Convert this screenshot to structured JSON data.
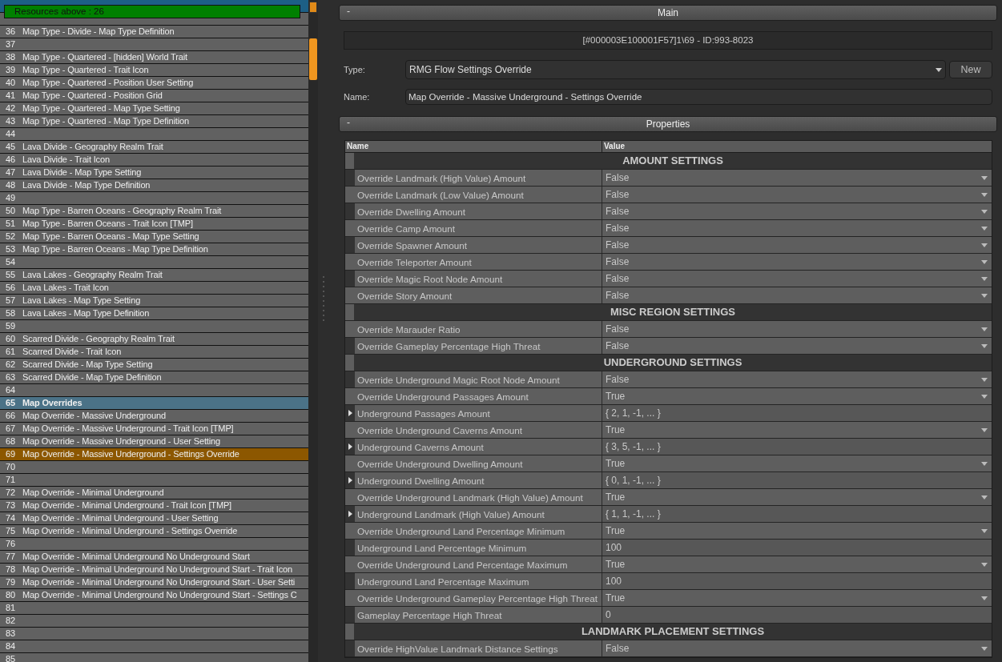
{
  "resource_list": {
    "banner": "Resources above : 26",
    "rows": [
      {
        "number": "36",
        "label": "Map Type - Divide - Map Type Definition",
        "kind": "item",
        "selected": false
      },
      {
        "number": "37",
        "kind": "item",
        "selected": false
      },
      {
        "number": "38",
        "label": "Map Type - Quartered - [hidden] World Trait",
        "kind": "item",
        "selected": false
      },
      {
        "number": "39",
        "label": "Map Type - Quartered - Trait Icon",
        "kind": "item",
        "selected": false
      },
      {
        "number": "40",
        "label": "Map Type - Quartered - Position User Setting",
        "kind": "item",
        "selected": false
      },
      {
        "number": "41",
        "label": "Map Type - Quartered - Position Grid",
        "kind": "item",
        "selected": false
      },
      {
        "number": "42",
        "label": "Map Type - Quartered - Map Type Setting",
        "kind": "item",
        "selected": false
      },
      {
        "number": "43",
        "label": "Map Type - Quartered - Map Type Definition",
        "kind": "item",
        "selected": false
      },
      {
        "number": "44",
        "kind": "item",
        "selected": false
      },
      {
        "number": "45",
        "label": "Lava Divide - Geography Realm Trait",
        "kind": "item",
        "selected": false
      },
      {
        "number": "46",
        "label": "Lava Divide - Trait Icon",
        "kind": "item",
        "selected": false
      },
      {
        "number": "47",
        "label": "Lava Divide - Map Type Setting",
        "kind": "item",
        "selected": false
      },
      {
        "number": "48",
        "label": "Lava Divide - Map Type Definition",
        "kind": "item",
        "selected": false
      },
      {
        "number": "49",
        "kind": "item",
        "selected": false
      },
      {
        "number": "50",
        "label": "Map Type - Barren Oceans - Geography Realm Trait",
        "kind": "item",
        "selected": false
      },
      {
        "number": "51",
        "label": "Map Type - Barren Oceans - Trait Icon [TMP]",
        "kind": "item",
        "selected": false
      },
      {
        "number": "52",
        "label": "Map Type - Barren Oceans - Map Type Setting",
        "kind": "item",
        "selected": false
      },
      {
        "number": "53",
        "label": "Map Type - Barren Oceans - Map Type Definition",
        "kind": "item",
        "selected": false
      },
      {
        "number": "54",
        "kind": "item",
        "selected": false
      },
      {
        "number": "55",
        "label": "Lava Lakes - Geography Realm Trait",
        "kind": "item",
        "selected": false
      },
      {
        "number": "56",
        "label": "Lava Lakes - Trait Icon",
        "kind": "item",
        "selected": false
      },
      {
        "number": "57",
        "label": "Lava Lakes - Map Type Setting",
        "kind": "item",
        "selected": false
      },
      {
        "number": "58",
        "label": "Lava Lakes - Map Type Definition",
        "kind": "item",
        "selected": false
      },
      {
        "number": "59",
        "kind": "item",
        "selected": false
      },
      {
        "number": "60",
        "label": "Scarred Divide - Geography Realm Trait",
        "kind": "item",
        "selected": false
      },
      {
        "number": "61",
        "label": "Scarred Divide - Trait Icon",
        "kind": "item",
        "selected": false
      },
      {
        "number": "62",
        "label": "Scarred Divide - Map Type Setting",
        "kind": "item",
        "selected": false
      },
      {
        "number": "63",
        "label": "Scarred Divide - Map Type Definition",
        "kind": "item",
        "selected": false
      },
      {
        "number": "64",
        "kind": "item",
        "selected": false
      },
      {
        "number": "65",
        "label": "Map Overrides",
        "kind": "header",
        "selected": false
      },
      {
        "number": "66",
        "label": "Map Override - Massive Underground",
        "kind": "item",
        "selected": false
      },
      {
        "number": "67",
        "label": "Map Override - Massive Underground - Trait Icon [TMP]",
        "kind": "item",
        "selected": false
      },
      {
        "number": "68",
        "label": "Map Override - Massive Underground - User Setting",
        "kind": "item",
        "selected": false
      },
      {
        "number": "69",
        "label": "Map Override - Massive Underground - Settings Override",
        "kind": "item",
        "selected": true
      },
      {
        "number": "70",
        "kind": "item",
        "selected": false
      },
      {
        "number": "71",
        "kind": "item",
        "selected": false
      },
      {
        "number": "72",
        "label": "Map Override - Minimal Underground",
        "kind": "item",
        "selected": false
      },
      {
        "number": "73",
        "label": "Map Override - Minimal Underground - Trait Icon [TMP]",
        "kind": "item",
        "selected": false
      },
      {
        "number": "74",
        "label": "Map Override - Minimal Underground - User Setting",
        "kind": "item",
        "selected": false
      },
      {
        "number": "75",
        "label": "Map Override - Minimal Underground - Settings Override",
        "kind": "item",
        "selected": false
      },
      {
        "number": "76",
        "kind": "item",
        "selected": false
      },
      {
        "number": "77",
        "label": "Map Override - Minimal Underground No Underground Start",
        "kind": "item",
        "selected": false
      },
      {
        "number": "78",
        "label": "Map Override - Minimal Underground No Underground Start - Trait Icon",
        "kind": "item",
        "selected": false
      },
      {
        "number": "79",
        "label": "Map Override - Minimal Underground No Underground Start - User Setti",
        "kind": "item",
        "selected": false
      },
      {
        "number": "80",
        "label": "Map Override - Minimal Underground No Underground Start - Settings C",
        "kind": "item",
        "selected": false
      },
      {
        "number": "81",
        "kind": "item",
        "selected": false
      },
      {
        "number": "82",
        "kind": "item",
        "selected": false
      },
      {
        "number": "83",
        "kind": "item",
        "selected": false
      },
      {
        "number": "84",
        "kind": "item",
        "selected": false
      },
      {
        "number": "85",
        "kind": "item",
        "selected": false
      }
    ]
  },
  "main": {
    "title": "Main",
    "collapse": "-",
    "id_text": "[#000003E100001F57]1\\69 - ID:993-8023",
    "type_label": "Type:",
    "type_value": "RMG Flow Settings Override",
    "new_button": "New",
    "name_label": "Name:",
    "name_value": "Map Override - Massive Underground - Settings Override"
  },
  "properties": {
    "title": "Properties",
    "collapse": "-",
    "columns": [
      "Name",
      "Value"
    ],
    "rows": [
      {
        "kind": "section",
        "name": "AMOUNT SETTINGS"
      },
      {
        "kind": "dropdown",
        "name": "Override Landmark (High Value) Amount",
        "value": "False"
      },
      {
        "kind": "dropdown",
        "name": "Override Landmark (Low Value) Amount",
        "value": "False"
      },
      {
        "kind": "dropdown",
        "name": "Override Dwelling  Amount",
        "value": "False"
      },
      {
        "kind": "dropdown",
        "name": "Override Camp Amount",
        "value": "False"
      },
      {
        "kind": "dropdown",
        "name": "Override Spawner Amount",
        "value": "False"
      },
      {
        "kind": "dropdown",
        "name": "Override Teleporter Amount",
        "value": "False"
      },
      {
        "kind": "dropdown",
        "name": "Override Magic Root Node Amount",
        "value": "False"
      },
      {
        "kind": "dropdown",
        "name": "Override Story Amount",
        "value": "False"
      },
      {
        "kind": "section",
        "name": "MISC REGION SETTINGS"
      },
      {
        "kind": "dropdown",
        "name": "Override Marauder Ratio",
        "value": "False"
      },
      {
        "kind": "dropdown",
        "name": "Override Gameplay Percentage High Threat",
        "value": "False"
      },
      {
        "kind": "section",
        "name": "UNDERGROUND SETTINGS"
      },
      {
        "kind": "dropdown",
        "name": "Override Underground Magic Root Node Amount",
        "value": "False"
      },
      {
        "kind": "dropdown",
        "name": "Override Underground Passages Amount",
        "value": "True"
      },
      {
        "kind": "array",
        "name": "Underground Passages Amount",
        "value": "{ 2, 1, -1, ... }",
        "expanded": false
      },
      {
        "kind": "dropdown",
        "name": "Override Underground Caverns Amount",
        "value": "True"
      },
      {
        "kind": "array",
        "name": "Underground Caverns Amount",
        "value": "{ 3, 5, -1, ... }",
        "expanded": false
      },
      {
        "kind": "dropdown",
        "name": "Override Underground Dwelling Amount",
        "value": "True"
      },
      {
        "kind": "array",
        "name": "Underground Dwelling Amount",
        "value": "{ 0, 1, -1, ... }",
        "expanded": false
      },
      {
        "kind": "dropdown",
        "name": "Override Underground Landmark (High Value) Amount",
        "value": "True"
      },
      {
        "kind": "array",
        "name": "Underground Landmark (High Value) Amount",
        "value": "{ 1, 1, -1, ... }",
        "expanded": false
      },
      {
        "kind": "dropdown",
        "name": "Override Underground Land Percentage Minimum",
        "value": "True"
      },
      {
        "kind": "number",
        "name": "Underground Land Percentage Minimum",
        "value": "100"
      },
      {
        "kind": "dropdown",
        "name": "Override Underground Land Percentage Maximum",
        "value": "True"
      },
      {
        "kind": "number",
        "name": "Underground Land Percentage Maximum",
        "value": "100"
      },
      {
        "kind": "dropdown",
        "name": "Override Underground Gameplay Percentage High Threat",
        "value": "True"
      },
      {
        "kind": "number",
        "name": "Gameplay Percentage High Threat",
        "value": "0"
      },
      {
        "kind": "section",
        "name": "LANDMARK PLACEMENT SETTINGS"
      },
      {
        "kind": "dropdown",
        "name": "Override HighValue Landmark Distance Settings",
        "value": "False"
      }
    ]
  }
}
